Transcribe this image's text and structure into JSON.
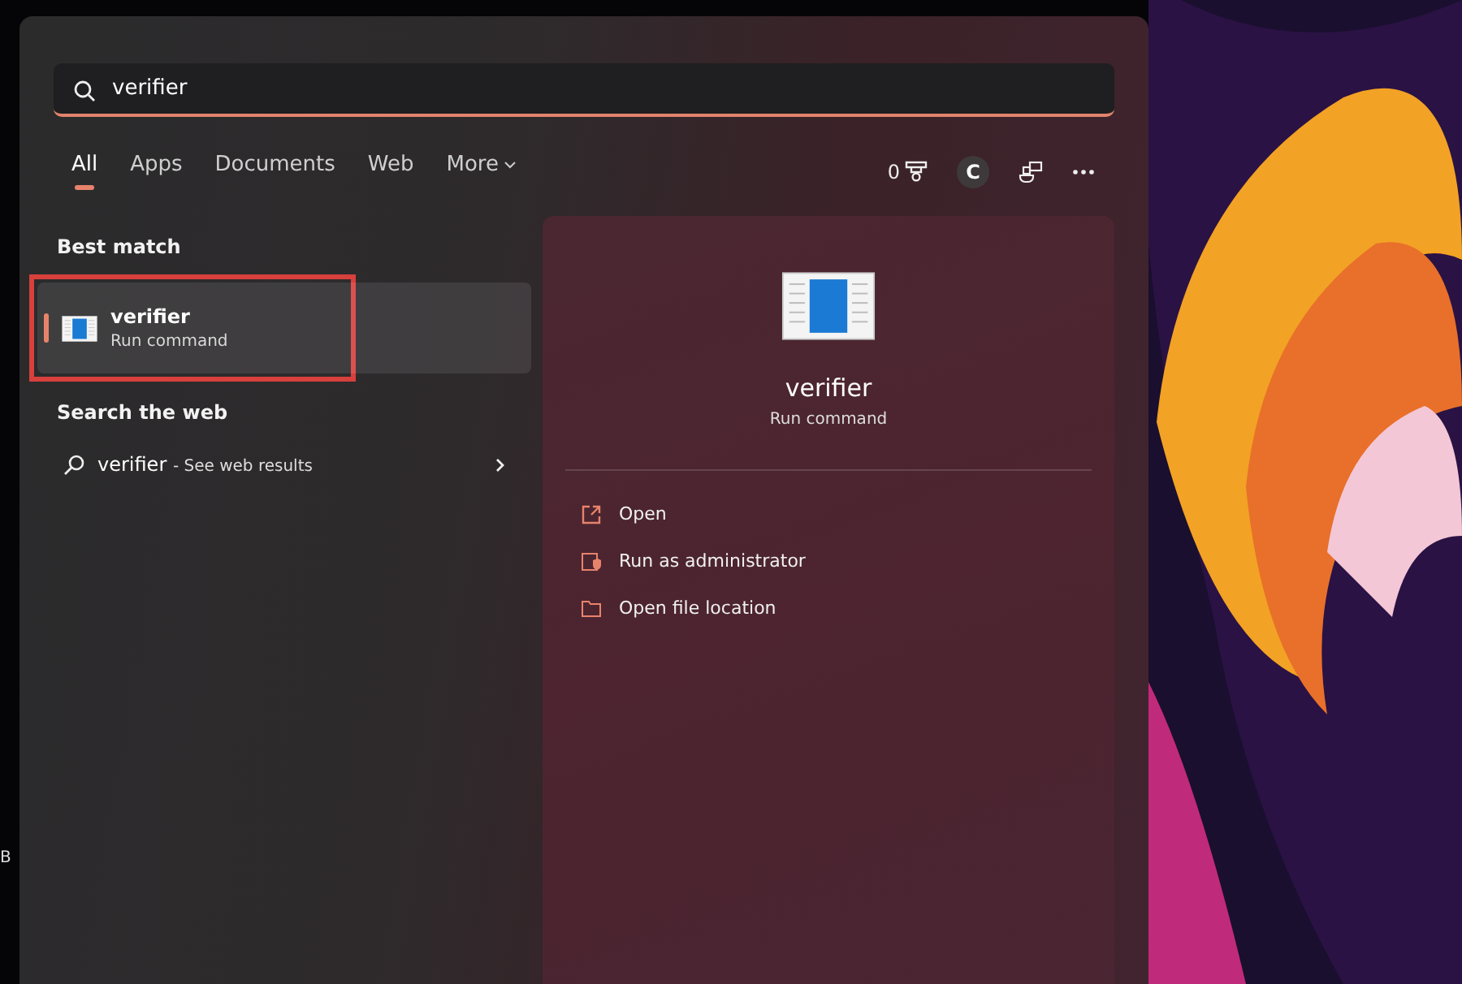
{
  "search": {
    "value": "verifier"
  },
  "filters": [
    {
      "label": "All",
      "selected": true,
      "kind": "plain"
    },
    {
      "label": "Apps",
      "selected": false,
      "kind": "plain"
    },
    {
      "label": "Documents",
      "selected": false,
      "kind": "plain"
    },
    {
      "label": "Web",
      "selected": false,
      "kind": "plain"
    },
    {
      "label": "More",
      "selected": false,
      "kind": "dropdown"
    }
  ],
  "toolbar": {
    "points": "0",
    "account_initial": "C"
  },
  "best_match": {
    "heading": "Best match",
    "title": "verifier",
    "subtitle": "Run command",
    "selected": true,
    "highlighted": true
  },
  "web": {
    "heading": "Search the web",
    "query": "verifier",
    "suffix": "- See web results"
  },
  "preview": {
    "title": "verifier",
    "subtitle": "Run command",
    "actions": [
      {
        "label": "Open",
        "kind": "open"
      },
      {
        "label": "Run as administrator",
        "kind": "admin"
      },
      {
        "label": "Open file location",
        "kind": "folder"
      }
    ]
  },
  "desktop": {
    "label": "B"
  }
}
